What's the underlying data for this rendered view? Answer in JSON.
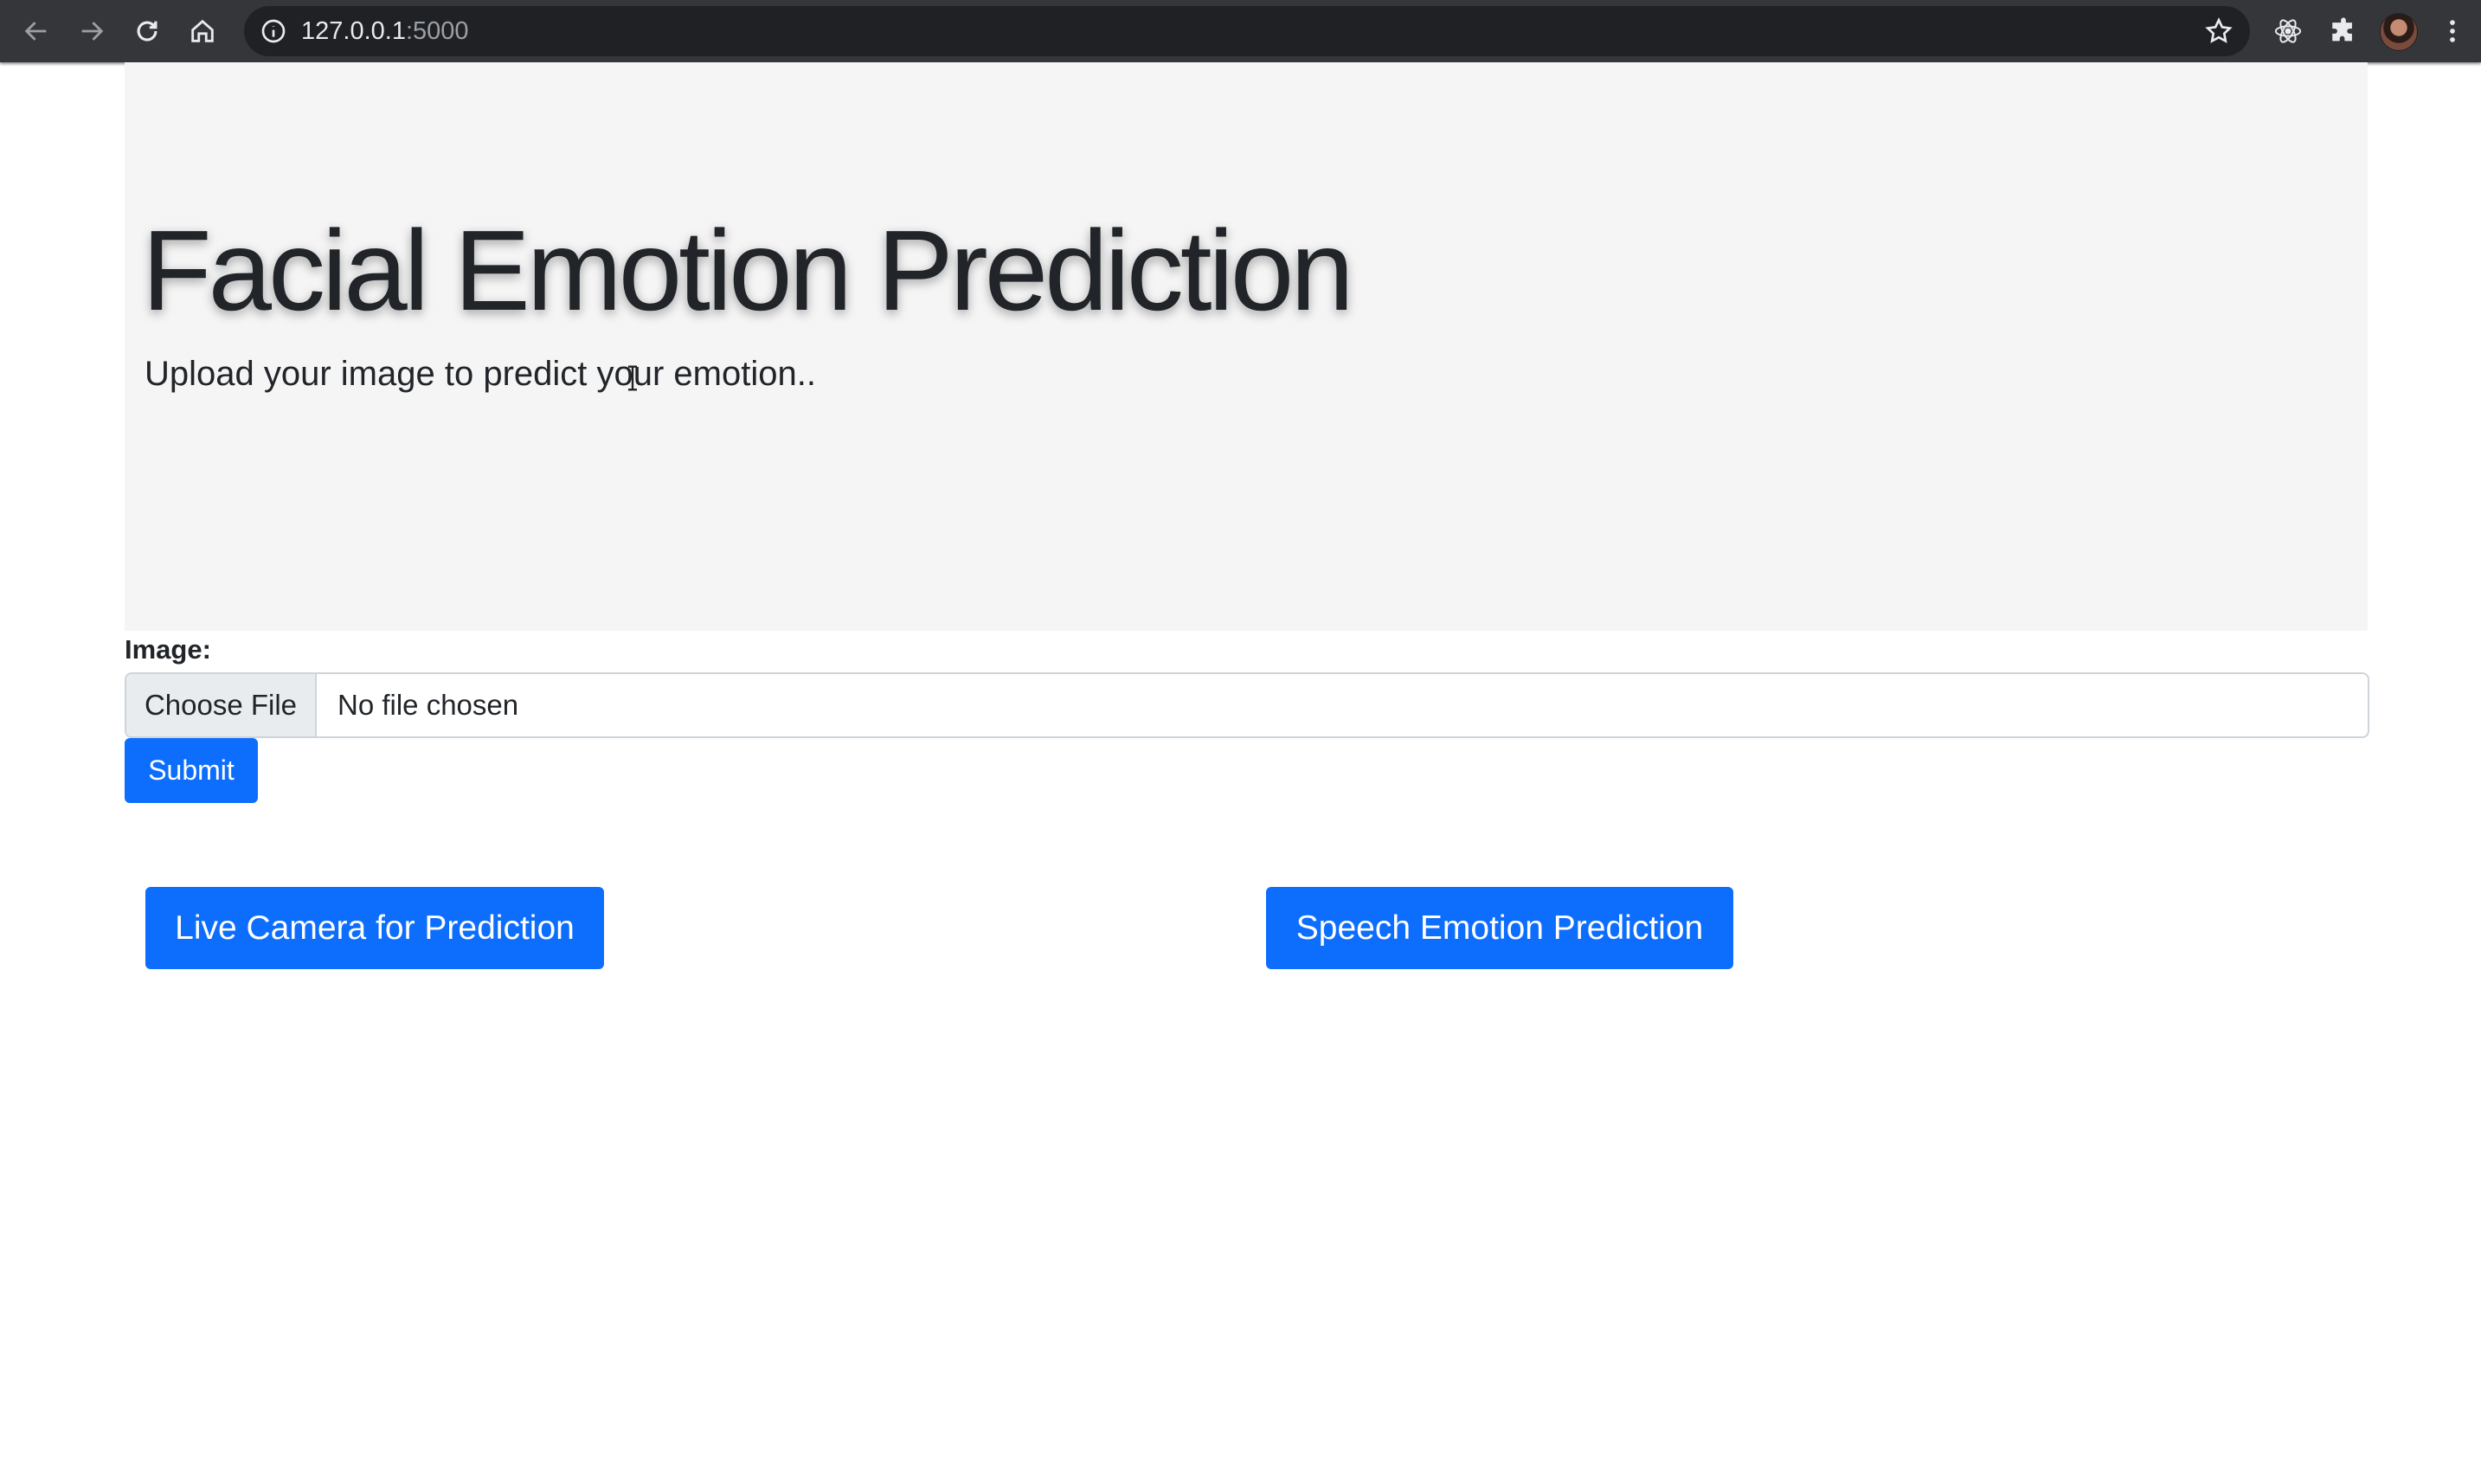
{
  "browser": {
    "url_host": "127.0.0.1",
    "url_port": ":5000",
    "icons": [
      "back-icon",
      "forward-icon",
      "reload-icon",
      "home-icon",
      "info-icon",
      "star-icon",
      "react-extension-icon",
      "extensions-puzzle-icon",
      "kebab-menu-icon"
    ]
  },
  "hero": {
    "title": "Facial Emotion Prediction",
    "subtitle": "Upload your image to predict your emotion.."
  },
  "form": {
    "image_label": "Image:",
    "choose_file_label": "Choose File",
    "file_status": "No file chosen",
    "submit_label": "Submit"
  },
  "actions": {
    "live_camera_label": "Live Camera for Prediction",
    "speech_label": "Speech Emotion Prediction"
  },
  "colors": {
    "primary": "#0d6efd",
    "jumbotron_bg": "#f5f5f5",
    "chrome_bg": "#35363a"
  }
}
